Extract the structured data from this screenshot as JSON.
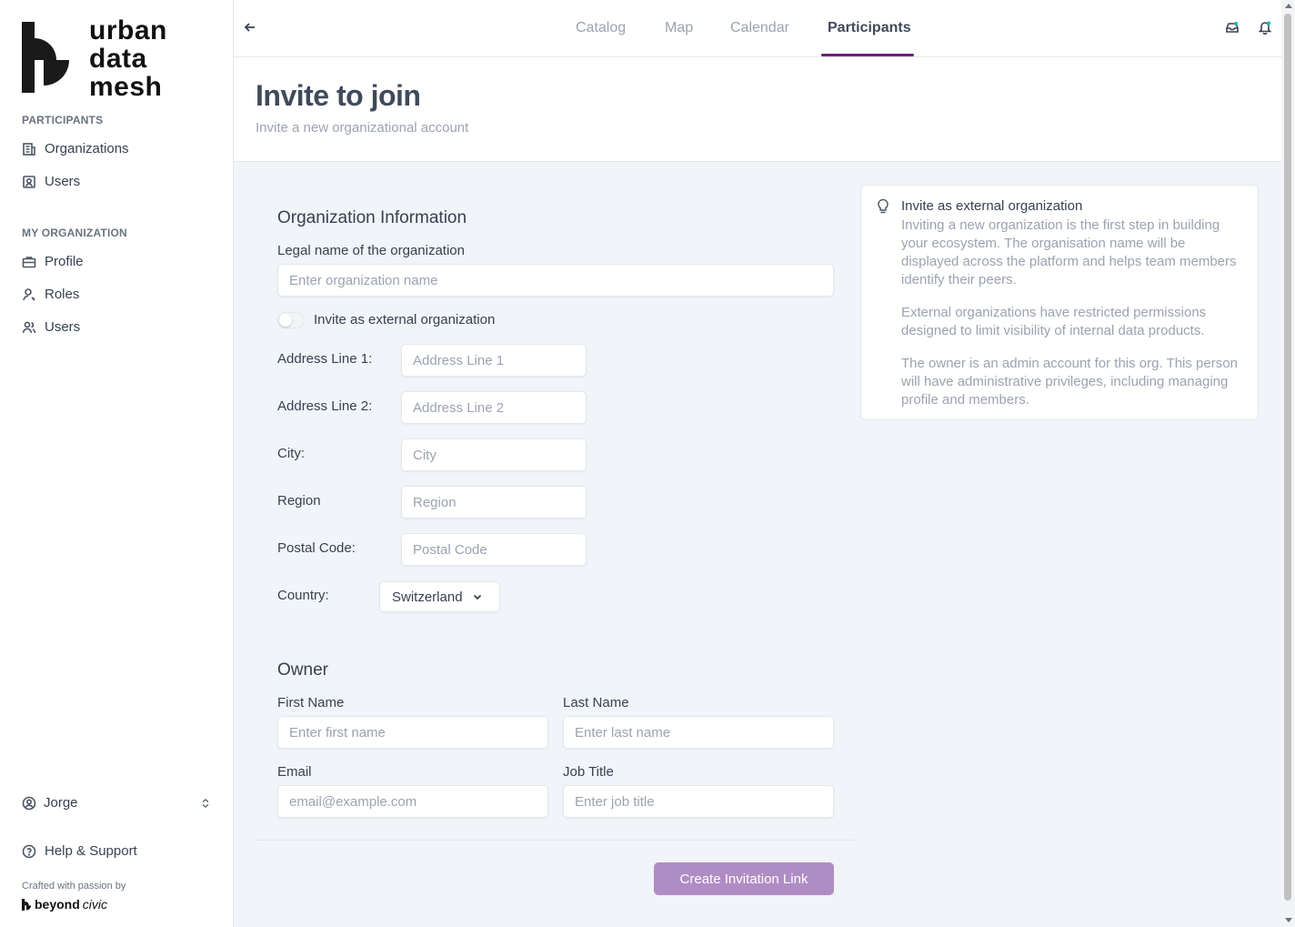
{
  "brand": {
    "line1": "urban",
    "line2": "data",
    "line3": "mesh"
  },
  "sidebar": {
    "participants_heading": "PARTICIPANTS",
    "participants_items": [
      {
        "label": "Organizations",
        "icon": "building-icon"
      },
      {
        "label": "Users",
        "icon": "user-badge-icon"
      }
    ],
    "my_org_heading": "MY ORGANIZATION",
    "my_org_items": [
      {
        "label": "Profile",
        "icon": "briefcase-icon"
      },
      {
        "label": "Roles",
        "icon": "user-key-icon"
      },
      {
        "label": "Users",
        "icon": "users-icon"
      }
    ],
    "user_name": "Jorge",
    "help_label": "Help & Support",
    "crafted_text": "Crafted with passion by",
    "footer_brand_bold": "beyond",
    "footer_brand_italic": "civic"
  },
  "topnav": {
    "tabs": [
      {
        "label": "Catalog",
        "active": false
      },
      {
        "label": "Map",
        "active": false
      },
      {
        "label": "Calendar",
        "active": false
      },
      {
        "label": "Participants",
        "active": true
      }
    ],
    "accent_color": "#6b1f7a"
  },
  "header": {
    "title": "Invite to join",
    "subtitle": "Invite a new organizational account"
  },
  "form": {
    "org_section_title": "Organization Information",
    "legal_name_label": "Legal name of the organization",
    "legal_name_placeholder": "Enter organization name",
    "external_toggle_label": "Invite as external organization",
    "external_toggle_on": false,
    "address1_label": "Address Line 1:",
    "address1_placeholder": "Address Line 1",
    "address2_label": "Address Line 2:",
    "address2_placeholder": "Address Line 2",
    "city_label": "City:",
    "city_placeholder": "City",
    "region_label": "Region",
    "region_placeholder": "Region",
    "postal_label": "Postal Code:",
    "postal_placeholder": "Postal Code",
    "country_label": "Country:",
    "country_value": "Switzerland",
    "owner_section_title": "Owner",
    "first_name_label": "First Name",
    "first_name_placeholder": "Enter first name",
    "last_name_label": "Last Name",
    "last_name_placeholder": "Enter last name",
    "email_label": "Email",
    "email_placeholder": "email@example.com",
    "job_title_label": "Job Title",
    "job_title_placeholder": "Enter job title",
    "submit_label": "Create Invitation Link",
    "submit_color": "#b08cc4"
  },
  "info": {
    "title": "Invite as external organization",
    "p1": "Inviting a new organization is the first step in building your ecosystem. The organisation name will be displayed across the platform and helps team members identify their peers.",
    "p2": "External organizations have restricted permissions designed to limit visibility of internal data products.",
    "p3": "The owner is an admin account for this org. This person will have administrative privileges, including managing profile and members."
  }
}
